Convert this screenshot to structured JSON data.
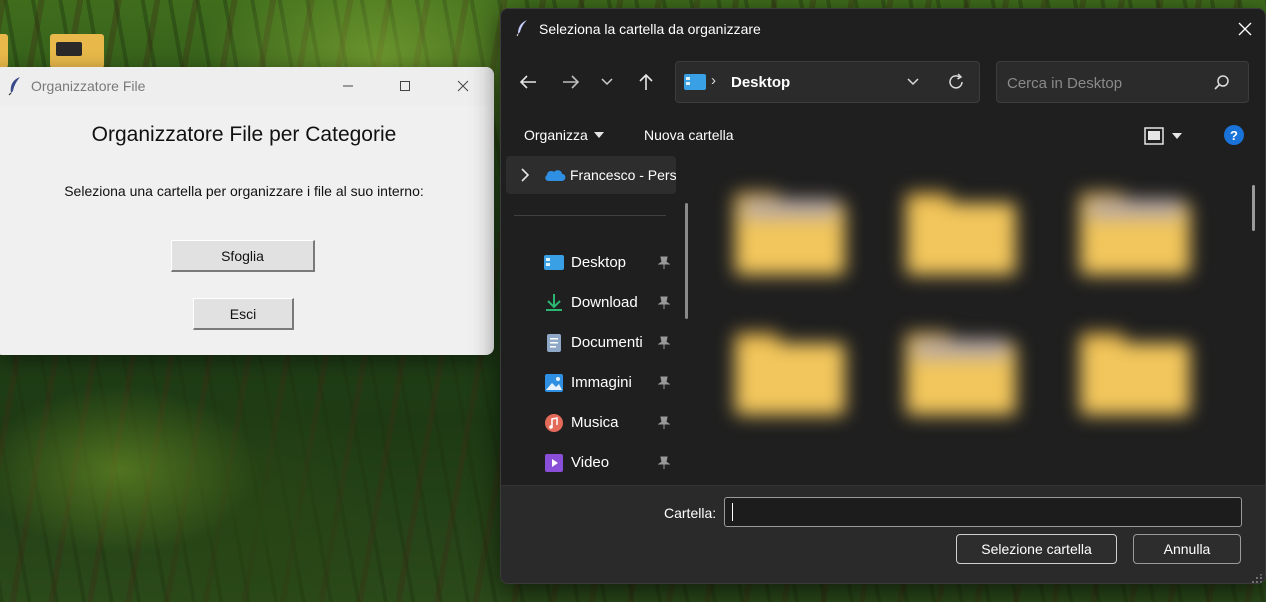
{
  "tk_window": {
    "title": "Organizzatore File",
    "heading": "Organizzatore File per Categorie",
    "instruction": "Seleziona una cartella per organizzare i file al suo interno:",
    "browse_label": "Sfoglia",
    "exit_label": "Esci"
  },
  "dialog": {
    "title": "Seleziona la cartella da organizzare",
    "address": {
      "separator": "›",
      "current": "Desktop"
    },
    "search": {
      "placeholder": "Cerca in Desktop"
    },
    "commands": {
      "organize": "Organizza",
      "new_folder": "Nuova cartella",
      "help": "?"
    },
    "nav": {
      "onedrive": "Francesco - Pers",
      "items": [
        {
          "label": "Desktop",
          "icon": "desktop-icon"
        },
        {
          "label": "Download",
          "icon": "download-icon"
        },
        {
          "label": "Documenti",
          "icon": "documents-icon"
        },
        {
          "label": "Immagini",
          "icon": "pictures-icon"
        },
        {
          "label": "Musica",
          "icon": "music-icon"
        },
        {
          "label": "Video",
          "icon": "video-icon"
        }
      ]
    },
    "footer": {
      "folder_label": "Cartella:",
      "folder_value": "",
      "select_label": "Selezione cartella",
      "cancel_label": "Annulla"
    }
  },
  "colors": {
    "dialog_bg": "#1f1f1f",
    "accent_blue": "#1a73d8",
    "folder_yellow": "#f2c65c"
  }
}
